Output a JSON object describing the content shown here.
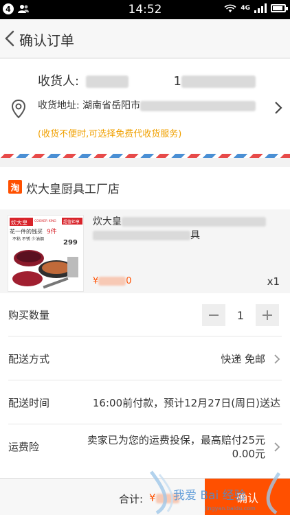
{
  "status_bar": {
    "notification_count": "4",
    "time": "14:52",
    "network": "4G",
    "battery_level": 0.85
  },
  "header": {
    "title": "确认订单"
  },
  "address": {
    "receiver_label": "收货人:",
    "receiver_phone_prefix": "1",
    "address_label": "收货地址:",
    "address_text": "湖南省岳阳市",
    "hint": "(收货不便时,可选择免费代收货服务)"
  },
  "store": {
    "logo_char": "淘",
    "name": "炊大皇厨具工厂店"
  },
  "product": {
    "name_start": "炊大皇",
    "name_end": "具",
    "price_prefix": "¥",
    "price_suffix": "0",
    "quantity": "x1",
    "thumb": {
      "brand": "炊大皇",
      "brand_en": "COOKER KING",
      "tag": "超值钜享",
      "slogan": "花一件的钱买",
      "count": "9件",
      "features": "不粘 不锈 少油烟",
      "price": "299"
    }
  },
  "rows": {
    "quantity_label": "购买数量",
    "quantity_value": "1",
    "delivery_label": "配送方式",
    "delivery_value": "快递 免邮",
    "time_label": "配送时间",
    "time_value": "16:00前付款，预计12月27日(周日)送达",
    "insurance_label": "运费险",
    "insurance_line1": "卖家已为您的运费投保，最高赔付25元",
    "insurance_line2": "0.00元"
  },
  "footer": {
    "total_label": "合计:",
    "total_value": "¥",
    "submit_label": "确认"
  },
  "watermark": {
    "text": "我爱 Bai 经验",
    "url": "jingyan.baidu.com"
  },
  "colors": {
    "accent": "#ff5000",
    "hint": "#f0a000"
  }
}
